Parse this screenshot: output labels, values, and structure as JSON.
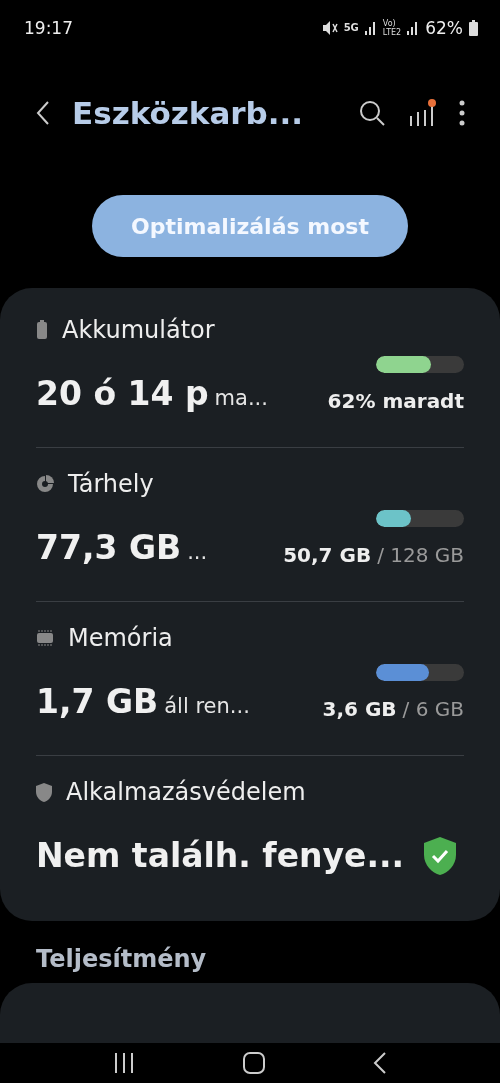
{
  "status_bar": {
    "time": "19:17",
    "network": "5G",
    "volte_top": "Vo)",
    "volte_bottom": "LTE2",
    "battery": "62%"
  },
  "header": {
    "title": "Eszközkarb..."
  },
  "optimize_button": {
    "label": "Optimalizálás most"
  },
  "metrics": [
    {
      "kind": "meter",
      "label": "Akkumulátor",
      "value": "20 ó 14 p",
      "suffix": "ma...",
      "level": 0.62,
      "color": "#8fd48f",
      "used": "62% maradt"
    },
    {
      "kind": "meter",
      "label": "Tárhely",
      "value": "77,3 GB",
      "suffix": "...",
      "level": 0.4,
      "color": "#6cc3c8",
      "used": "50,7 GB",
      "total": "/ 128 GB"
    },
    {
      "kind": "meter",
      "label": "Memória",
      "value": "1,7 GB",
      "suffix": "áll ren...",
      "level": 0.6,
      "color": "#5b8fd6",
      "used": "3,6 GB",
      "total": "/ 6 GB"
    },
    {
      "kind": "status",
      "label": "Alkalmazásvédelem",
      "value": "Nem találh. fenye...",
      "ok": true
    }
  ],
  "section": {
    "title": "Teljesítmény"
  }
}
